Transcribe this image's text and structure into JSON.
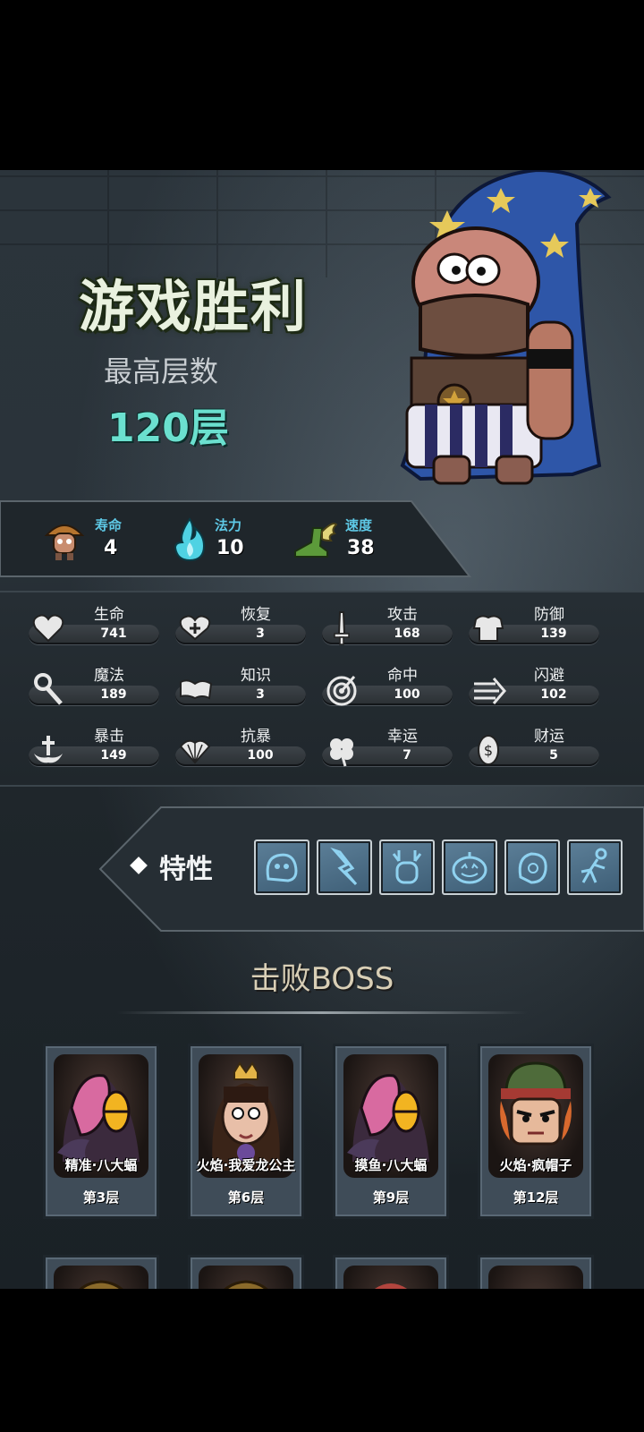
{
  "header": {
    "title": "游戏胜利",
    "floor_label": "最高层数",
    "floor_value": "120层"
  },
  "top_stats": [
    {
      "label": "寿命",
      "value": "4",
      "icon": "mushroom-hero-icon"
    },
    {
      "label": "法力",
      "value": "10",
      "icon": "blue-flame-icon"
    },
    {
      "label": "速度",
      "value": "38",
      "icon": "winged-boot-icon"
    }
  ],
  "attributes": [
    {
      "label": "生命",
      "value": "741",
      "icon": "heart-icon"
    },
    {
      "label": "恢复",
      "value": "3",
      "icon": "heart-plus-icon"
    },
    {
      "label": "攻击",
      "value": "168",
      "icon": "sword-icon"
    },
    {
      "label": "防御",
      "value": "139",
      "icon": "armor-icon"
    },
    {
      "label": "魔法",
      "value": "189",
      "icon": "staff-icon"
    },
    {
      "label": "知识",
      "value": "3",
      "icon": "book-icon"
    },
    {
      "label": "命中",
      "value": "100",
      "icon": "target-icon"
    },
    {
      "label": "闪避",
      "value": "102",
      "icon": "dash-arrow-icon"
    },
    {
      "label": "暴击",
      "value": "149",
      "icon": "crit-cross-icon"
    },
    {
      "label": "抗暴",
      "value": "100",
      "icon": "shell-icon"
    },
    {
      "label": "幸运",
      "value": "7",
      "icon": "clover-icon"
    },
    {
      "label": "财运",
      "value": "5",
      "icon": "coin-icon"
    }
  ],
  "traits": {
    "label": "特性",
    "items": [
      "slime-trait-icon",
      "lightning-trait-icon",
      "antler-trait-icon",
      "pumpkin-trait-icon",
      "blob-trait-icon",
      "runner-trait-icon"
    ]
  },
  "bosses": {
    "title": "击败BOSS",
    "items": [
      {
        "name": "精准·八大蝠",
        "floor": "第3层"
      },
      {
        "name": "火焰·我爱龙公主",
        "floor": "第6层"
      },
      {
        "name": "摸鱼·八大蝠",
        "floor": "第9层"
      },
      {
        "name": "火焰·疯帽子",
        "floor": "第12层"
      }
    ]
  },
  "colors": {
    "title_text": "#e9f1df",
    "floor_value": "#6be0cf",
    "stat_label": "#5ec9e6",
    "boss_title": "#d9cfb6"
  }
}
